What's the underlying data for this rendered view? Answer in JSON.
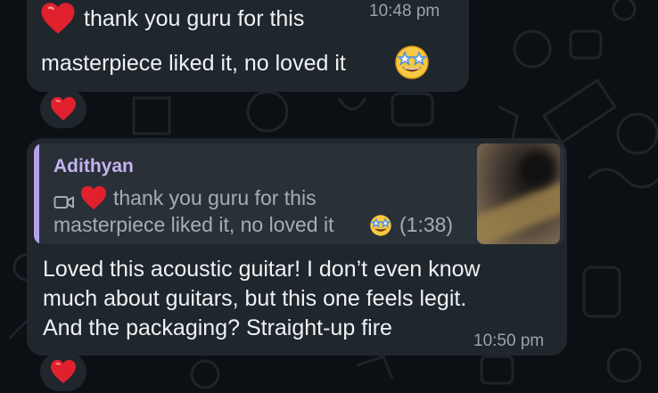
{
  "messages": [
    {
      "line1": "thank you guru for this",
      "line2": "masterpiece liked it, no loved it",
      "time": "10:48 pm",
      "reaction": "heart"
    },
    {
      "reply": {
        "author": "Adithyan",
        "line1": "thank you guru for this",
        "line2": "masterpiece liked it, no loved it",
        "duration": "(1:38)",
        "media_icon": "video-camera-icon"
      },
      "line1": "Loved this acoustic guitar! I don’t even know",
      "line2": "much about guitars, but this one feels legit.",
      "line3": "And the packaging? Straight-up fire",
      "time": "10:50 pm",
      "reaction": "heart"
    }
  ],
  "colors": {
    "background": "#0c1014",
    "bubble": "#1f262c",
    "reply_accent": "#b6a2ec",
    "heart": "#e0212d"
  }
}
